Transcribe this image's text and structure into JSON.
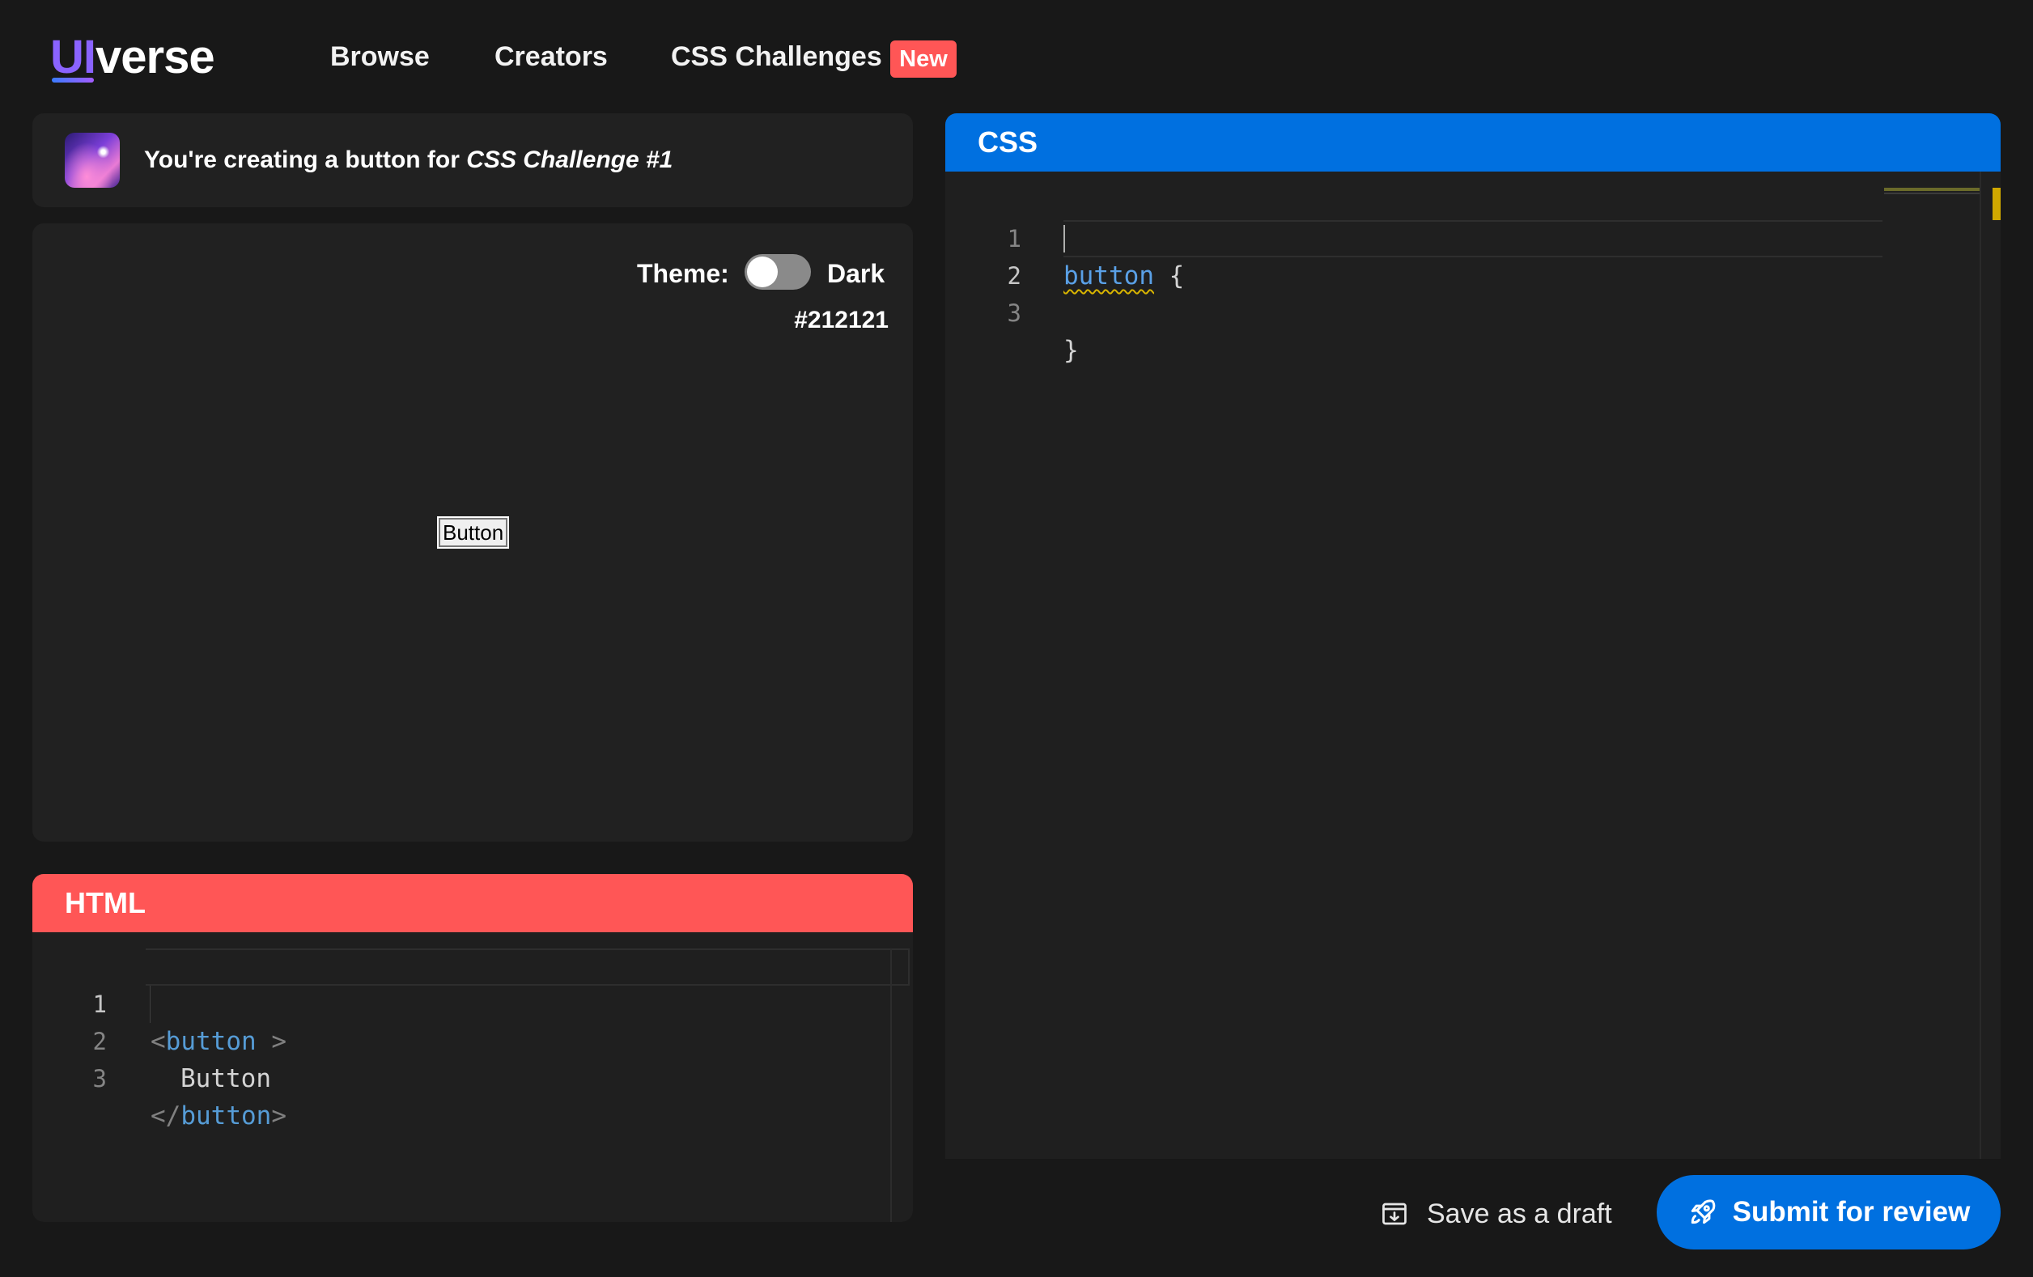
{
  "brand": {
    "logo_ui": "UI",
    "logo_verse": "verse"
  },
  "nav": {
    "items": [
      {
        "label": "Browse"
      },
      {
        "label": "Creators"
      },
      {
        "label": "CSS Challenges"
      }
    ],
    "badge": "New"
  },
  "challenge": {
    "prefix": "You're creating a button for ",
    "name": "CSS Challenge #1"
  },
  "preview": {
    "theme_label": "Theme:",
    "theme_value": "Dark",
    "background_hex": "#212121",
    "button_label": "Button"
  },
  "html_editor": {
    "title": "HTML",
    "lines": [
      {
        "number": "1",
        "open": "<",
        "tag": "button",
        "close": " >"
      },
      {
        "number": "2",
        "text": "Button"
      },
      {
        "number": "3",
        "open": "</",
        "tag": "button",
        "close": ">"
      }
    ]
  },
  "css_editor": {
    "title": "CSS",
    "lines": [
      {
        "number": "1",
        "selector": "button",
        "text": " {"
      },
      {
        "number": "2",
        "text": ""
      },
      {
        "number": "3",
        "text": "}"
      }
    ]
  },
  "actions": {
    "draft_label": "Save as a draft",
    "submit_label": "Submit for review"
  },
  "colors": {
    "background": "#181818",
    "panel": "#212121",
    "html_accent": "#ff5656",
    "css_accent": "#0070e0"
  },
  "icons": {
    "draft": "archive-download-icon",
    "submit": "rocket-icon"
  }
}
